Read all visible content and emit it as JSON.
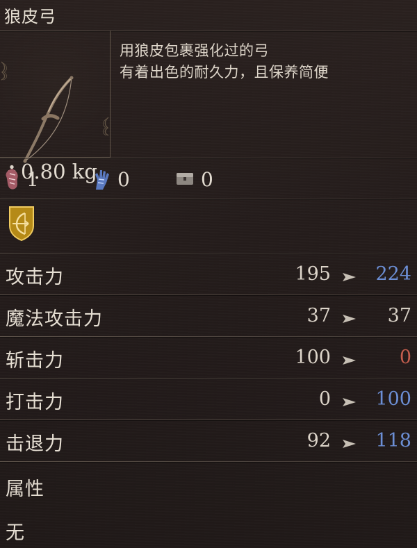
{
  "item": {
    "title": "狼皮弓",
    "description_line_1": "用狼皮包裹强化过的弓",
    "description_line_2": "有着出色的耐久力，且保养简便",
    "weight": "0.80 kg",
    "icon": "bow-icon"
  },
  "requirements": [
    {
      "icon": "strength-icon",
      "value": "1",
      "color": "#c98c92"
    },
    {
      "icon": "dexterity-icon",
      "value": "0",
      "color": "#7e98d6"
    },
    {
      "icon": "chest-icon",
      "value": "0",
      "color": "#b3aca2"
    }
  ],
  "category": {
    "icon": "bow-shield-icon",
    "color": "#c99b21"
  },
  "stats": [
    {
      "label": "攻击力",
      "base": "195",
      "new": "224",
      "new_color": "#6c8fd5"
    },
    {
      "label": "魔法攻击力",
      "base": "37",
      "new": "37",
      "new_color": "#d5cec3"
    },
    {
      "label": "斩击力",
      "base": "100",
      "new": "0",
      "new_color": "#c55e4e"
    },
    {
      "label": "打击力",
      "base": "0",
      "new": "100",
      "new_color": "#6c8fd5"
    },
    {
      "label": "击退力",
      "base": "92",
      "new": "118",
      "new_color": "#6c8fd5"
    }
  ],
  "attribute": {
    "label": "属性",
    "value": "无"
  }
}
